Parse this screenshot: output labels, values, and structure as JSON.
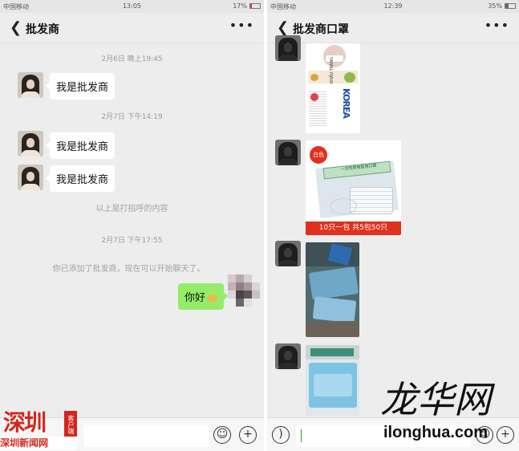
{
  "left_screen": {
    "status_bar": {
      "carrier": "中国移动",
      "time": "13:05",
      "battery": "17%"
    },
    "header": {
      "title": "批发商"
    },
    "messages": [
      {
        "type": "timestamp",
        "text": "2月6日 晚上19:45"
      },
      {
        "type": "incoming",
        "text": "我是批发商"
      },
      {
        "type": "timestamp",
        "text": "2月7日 下午14:19"
      },
      {
        "type": "incoming",
        "text": "我是批发商"
      },
      {
        "type": "incoming",
        "text": "我是批发商"
      },
      {
        "type": "system",
        "text": "以上是打招呼的内容"
      },
      {
        "type": "timestamp",
        "text": "2月7日 下午17:55"
      },
      {
        "type": "system",
        "text": "你已添加了批发商，现在可以开始聊天了。"
      },
      {
        "type": "outgoing",
        "text": "你好"
      }
    ]
  },
  "right_screen": {
    "status_bar": {
      "carrier": "中国移动",
      "time": "12:39",
      "battery": "35%"
    },
    "header": {
      "title": "批发商口罩"
    },
    "images": [
      {
        "label": "KOREA",
        "sublabel": "KHẨU TRANG"
      },
      {
        "badge": "白色",
        "package_label": "一次性使用医用口罩",
        "caption": "10只一包 共5包50只"
      },
      {
        "label": ""
      },
      {
        "label": ""
      }
    ]
  },
  "watermarks": {
    "left_logo_main": "深圳",
    "left_logo_sub": "客户端",
    "left_logo_caption": "深圳新闻网",
    "right_logo_main": "龙华网",
    "right_logo_url": "ilonghua.com"
  },
  "colors": {
    "chat_background": "#ededed",
    "outgoing_bubble": "#95ec69",
    "incoming_bubble": "#ffffff",
    "caption_red": "#e0301e",
    "battery_low": "#dd3333"
  },
  "icons": [
    "back-arrow-icon",
    "more-icon",
    "emoji-icon",
    "plus-icon",
    "voice-icon"
  ]
}
